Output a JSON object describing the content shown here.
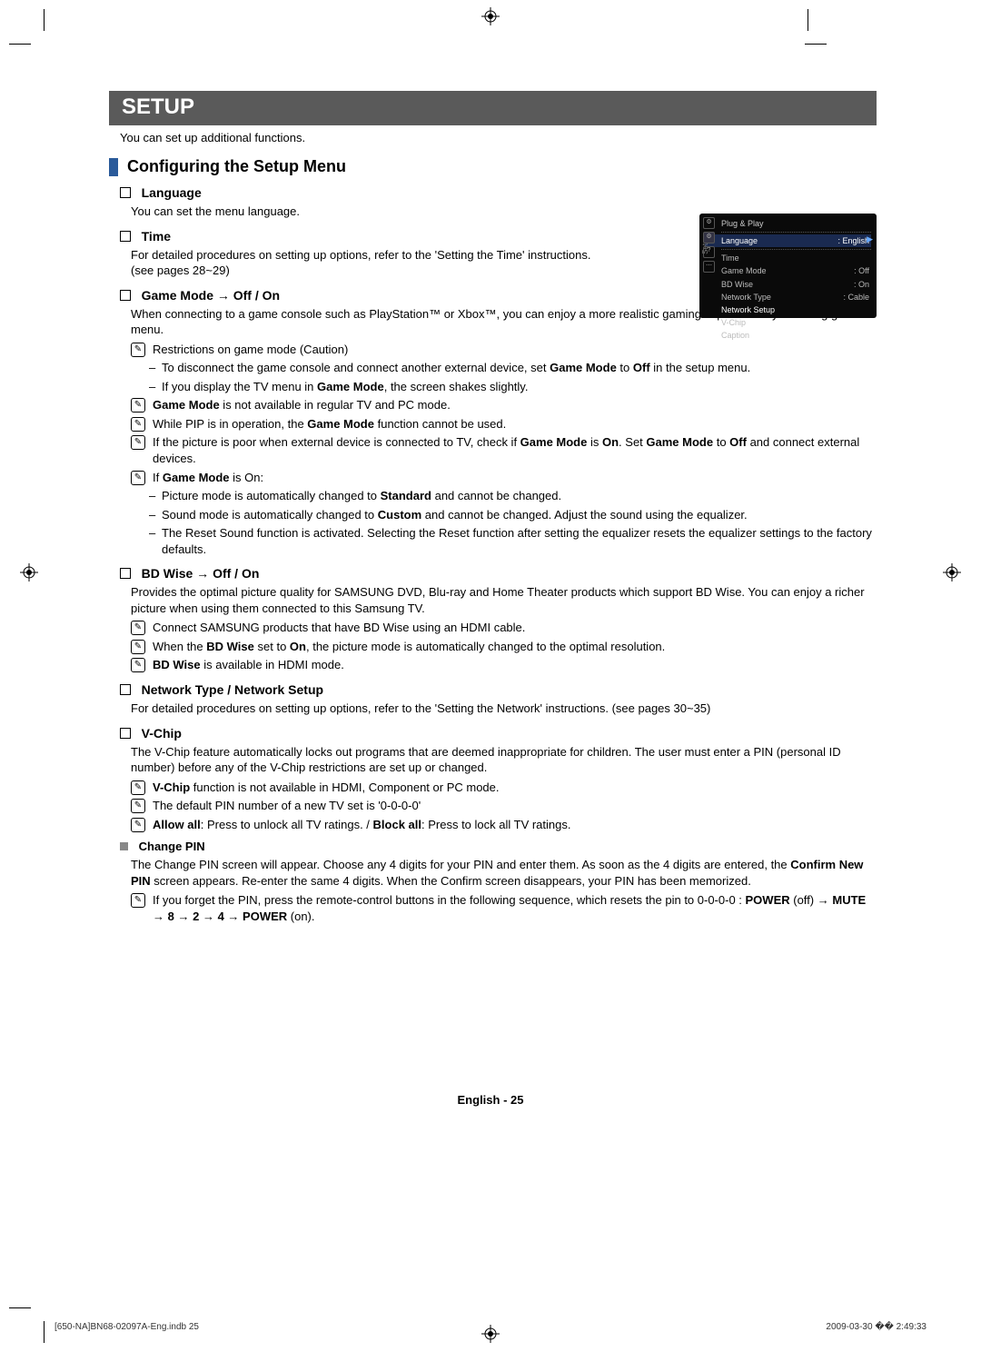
{
  "banner": "SETUP",
  "intro": "You can set up additional functions.",
  "subheading": "Configuring the Setup Menu",
  "language": {
    "title": "Language",
    "desc": "You can set the menu language."
  },
  "time": {
    "title": "Time",
    "desc": "For detailed procedures on setting up options, refer to the 'Setting the Time' instructions. (see pages 28~29)"
  },
  "gamemode": {
    "title": "Game Mode → Off / On",
    "desc": "When connecting to a game console such as PlayStation™ or Xbox™, you can enjoy a more realistic gaming experience by selecting game menu.",
    "note1": "Restrictions on game mode (Caution)",
    "dash1": "To disconnect the game console and connect another external device, set <b>Game Mode</b> to <b>Off</b> in the setup menu.",
    "dash2": "If you display the TV menu in <b>Game Mode</b>, the screen shakes slightly.",
    "note2": "<b>Game Mode</b> is not available in regular TV and PC mode.",
    "note3": "While PIP is in operation, the <b>Game Mode</b> function cannot be used.",
    "note4": "If the picture is poor when external device is connected to TV, check if <b>Game Mode</b> is <b>On</b>. Set <b>Game Mode</b> to <b>Off</b> and connect external devices.",
    "note5": "If <b>Game Mode</b> is On:",
    "dash3": "Picture mode is automatically changed to <b>Standard</b> and cannot be changed.",
    "dash4": "Sound mode is automatically changed to <b>Custom</b> and cannot be changed. Adjust the sound using the equalizer.",
    "dash5": "The Reset Sound function is activated. Selecting the Reset function after setting the equalizer resets the equalizer settings to the factory defaults."
  },
  "bdwise": {
    "title": "BD Wise → Off / On",
    "desc": "Provides the optimal picture quality for SAMSUNG DVD, Blu-ray and Home Theater products which support BD Wise. You can enjoy a richer picture when using them connected to this Samsung TV.",
    "note1": "Connect SAMSUNG products that have BD Wise using an HDMI cable.",
    "note2": "When the <b>BD Wise</b> set to <b>On</b>, the picture mode is automatically changed to the optimal resolution.",
    "note3": "<b>BD Wise</b> is available in HDMI mode."
  },
  "network": {
    "title": "Network Type / Network Setup",
    "desc": "For detailed procedures on setting up options, refer to the 'Setting the Network' instructions. (see pages 30~35)"
  },
  "vchip": {
    "title": "V-Chip",
    "desc": "The V-Chip feature automatically locks out programs that are deemed inappropriate for children. The user must enter a PIN (personal ID number) before any of the V-Chip restrictions are set up or changed.",
    "note1": "<b>V-Chip</b> function is not available in HDMI, Component or PC mode.",
    "note2": "The default PIN number of a new TV set is '0-0-0-0'",
    "note3": "<b>Allow all</b>: Press to unlock all TV ratings. / <b>Block all</b>: Press to lock all TV ratings."
  },
  "changepin": {
    "title": "Change PIN",
    "desc": "The Change PIN screen will appear. Choose any 4 digits for your PIN and enter them. As soon as the 4 digits are entered, the <b>Confirm New PIN</b> screen appears. Re-enter the same 4 digits. When the Confirm screen disappears, your PIN has been memorized.",
    "note1": "If you forget the PIN, press the remote-control buttons in the following sequence, which resets the pin to 0-0-0-0 : <b>POWER</b> (off) → <b>MUTE</b> → <b>8</b> → <b>2</b> → <b>4</b> → <b>POWER</b> (on)."
  },
  "menu": {
    "top": "Plug & Play",
    "sel_label": "Language",
    "sel_value": ": English",
    "rows": [
      {
        "l": "Time",
        "v": ""
      },
      {
        "l": "Game Mode",
        "v": ": Off"
      },
      {
        "l": "BD Wise",
        "v": ": On"
      },
      {
        "l": "Network Type",
        "v": ": Cable"
      },
      {
        "l": "Network Setup",
        "v": ""
      },
      {
        "l": "V-Chip",
        "v": ""
      },
      {
        "l": "Caption",
        "v": ""
      }
    ],
    "side": "Setup"
  },
  "footer": "English - 25",
  "print_left": "[650-NA]BN68-02097A-Eng.indb   25",
  "print_right": "2009-03-30   �� 2:49:33"
}
